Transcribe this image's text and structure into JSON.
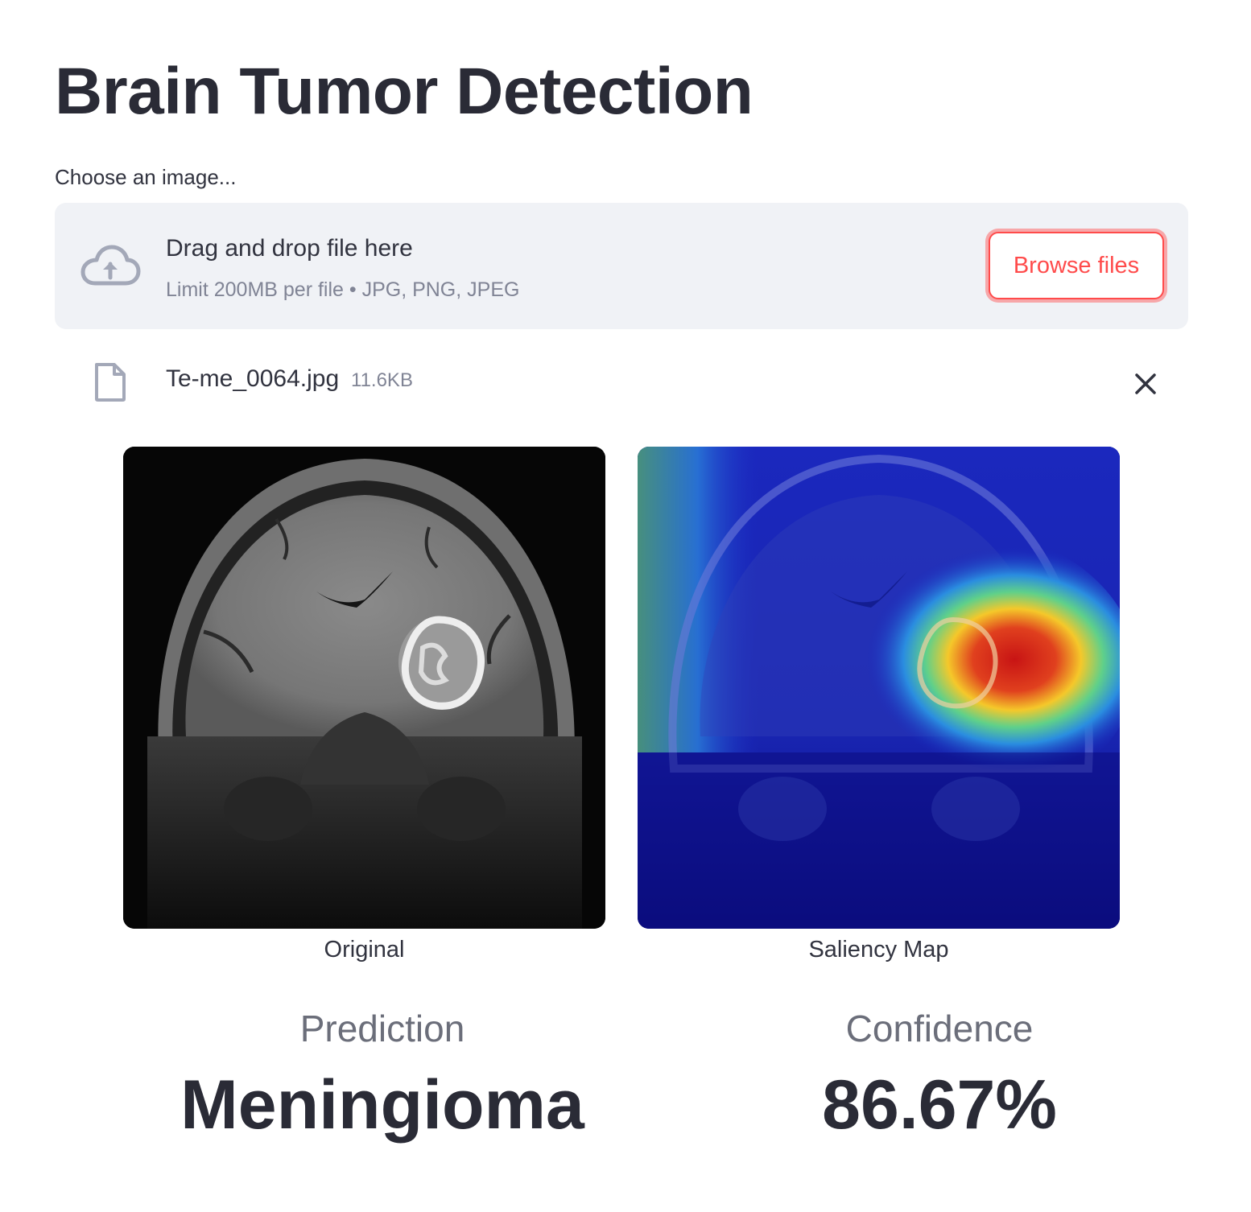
{
  "page": {
    "title": "Brain Tumor Detection"
  },
  "uploader": {
    "label": "Choose an image...",
    "instructions": "Drag and drop file here",
    "limit_text": "Limit 200MB per file • JPG, PNG, JPEG",
    "browse_label": "Browse files",
    "icon": "cloud-upload-icon"
  },
  "uploaded_file": {
    "name": "Te-me_0064.jpg",
    "size": "11.6KB",
    "icon": "file-icon",
    "remove_icon": "close-icon"
  },
  "images": {
    "original_caption": "Original",
    "saliency_caption": "Saliency Map"
  },
  "results": {
    "prediction_label": "Prediction",
    "prediction_value": "Meningioma",
    "confidence_label": "Confidence",
    "confidence_value": "86.67%"
  },
  "colors": {
    "accent": "#ff4b4b",
    "text": "#31333f",
    "muted": "#808495",
    "dropzone_bg": "#f0f2f6"
  }
}
